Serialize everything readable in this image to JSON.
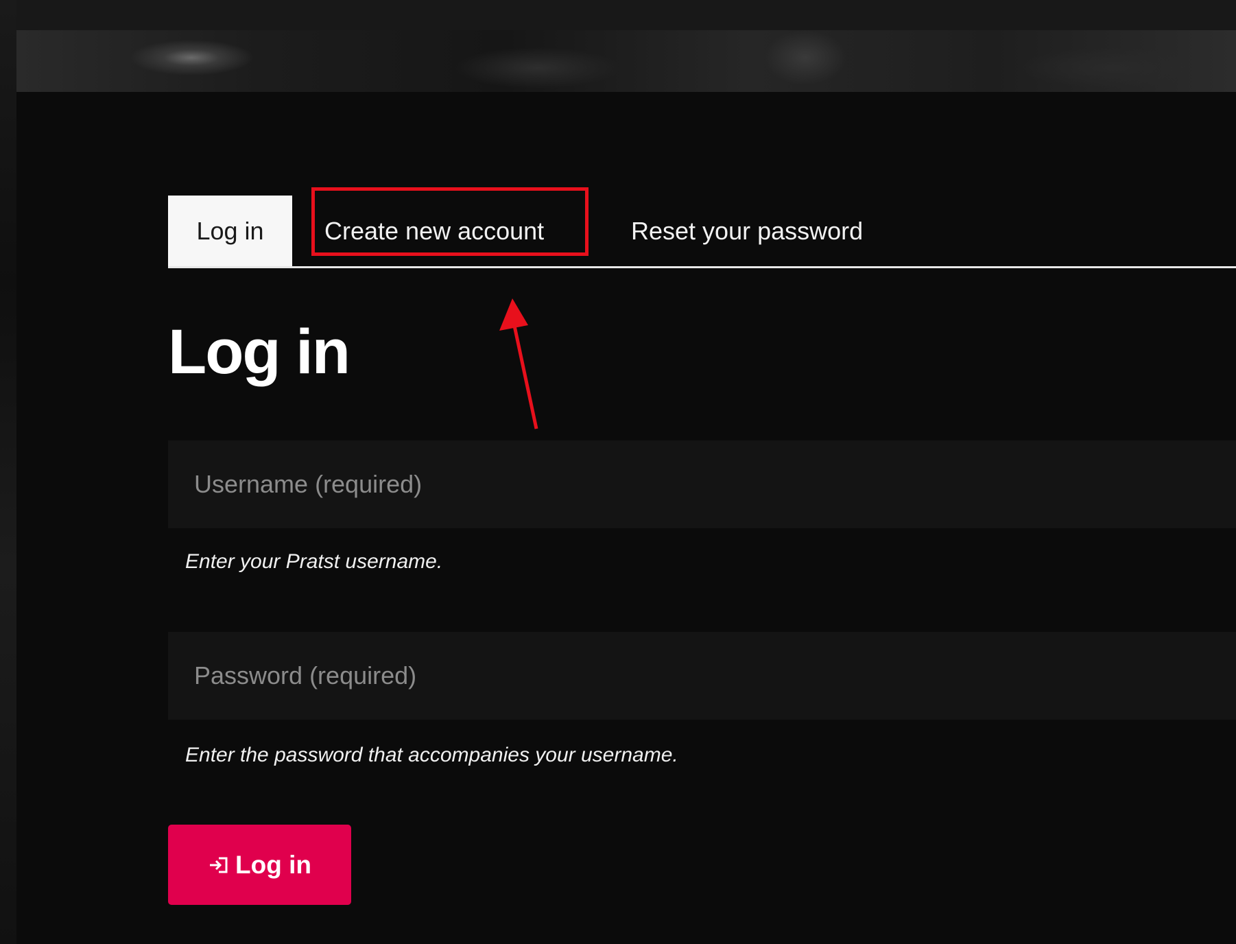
{
  "tabs": {
    "login_label": "Log in",
    "create_label": "Create new account",
    "reset_label": "Reset your password"
  },
  "page": {
    "title": "Log in"
  },
  "form": {
    "username_placeholder": "Username (required)",
    "username_help": "Enter your Pratst username.",
    "password_placeholder": "Password (required)",
    "password_help": "Enter the password that accompanies your username.",
    "submit_label": "Log in",
    "submit_icon": "login-icon"
  },
  "annotation": {
    "color": "#e8101c",
    "highlighted_item": "Create new account"
  },
  "colors": {
    "accent": "#e0004d",
    "background": "#0b0b0b"
  }
}
